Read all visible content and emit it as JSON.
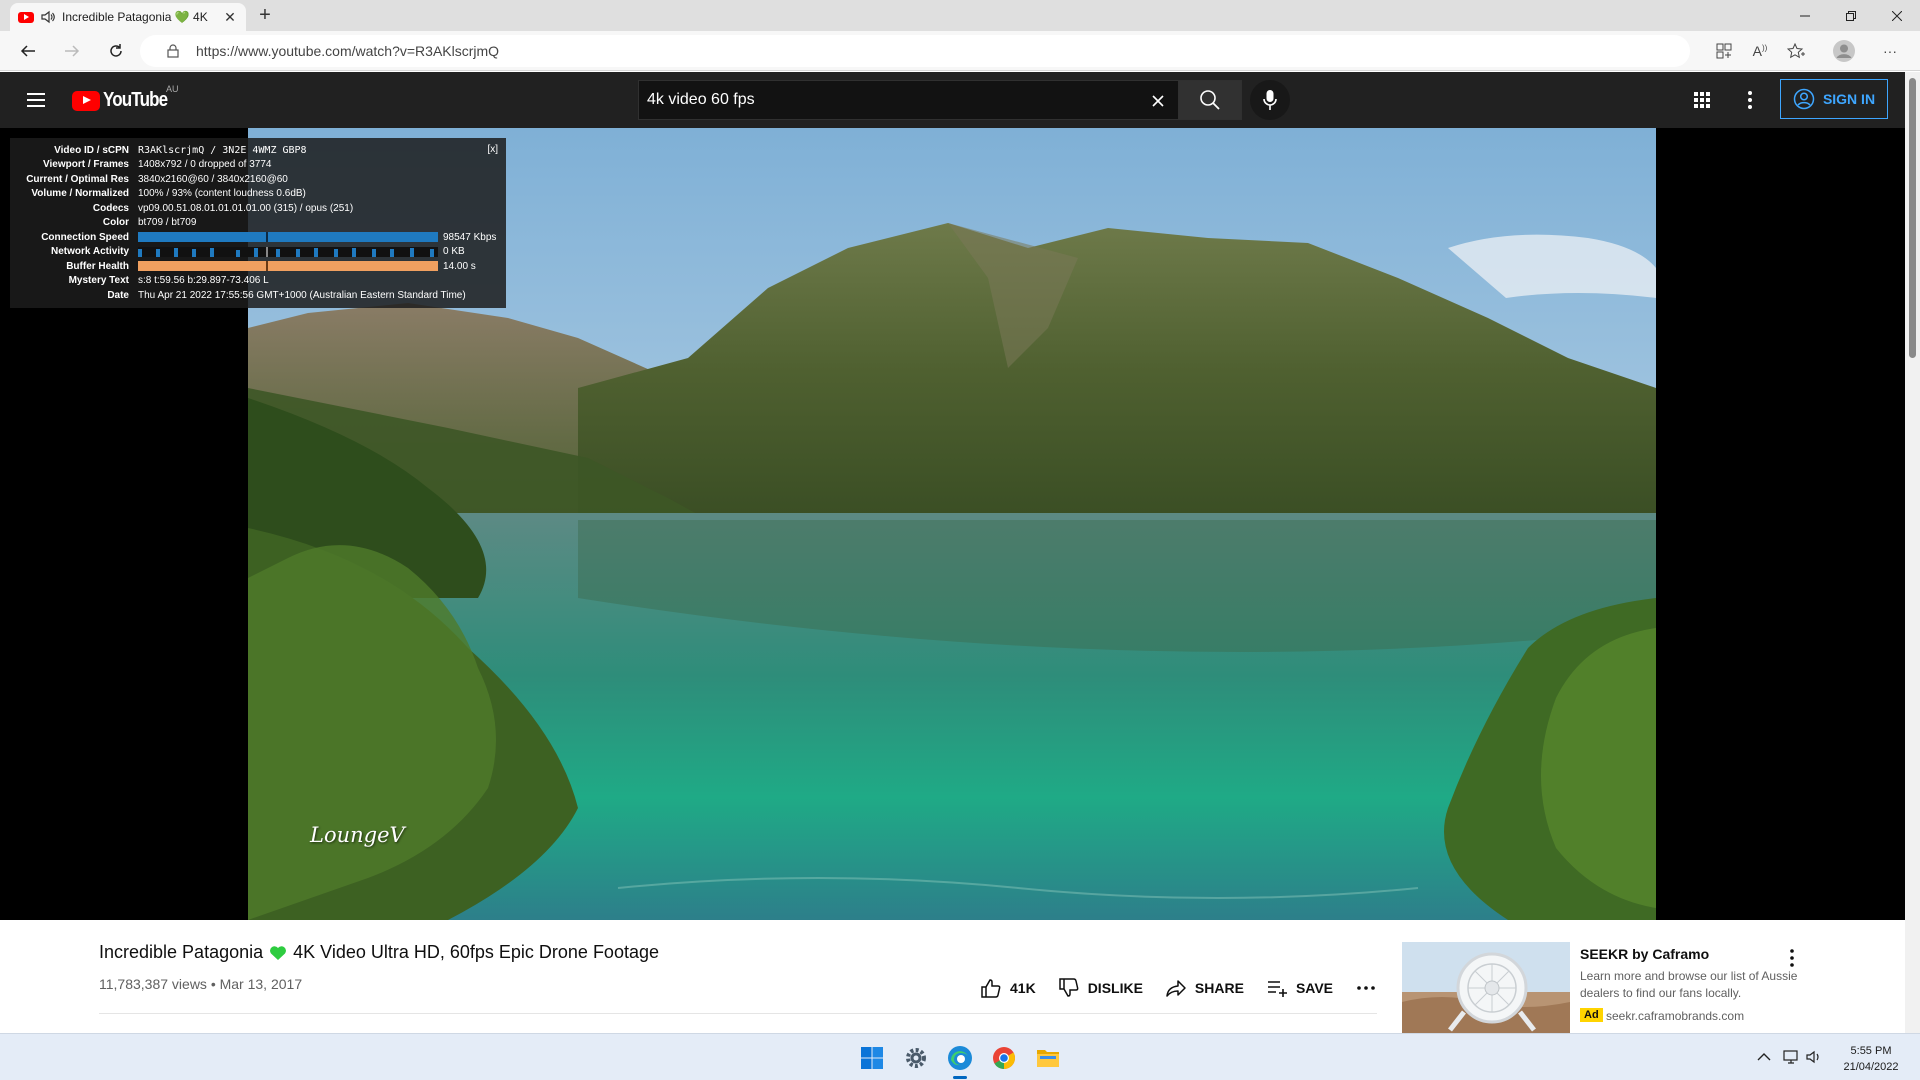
{
  "browser": {
    "tab_title": "Incredible Patagonia 💚 4K",
    "url": "https://www.youtube.com/watch?v=R3AKlscrjmQ"
  },
  "youtube": {
    "logo_text": "YouTube",
    "country": "AU",
    "search_value": "4k video 60 fps",
    "signin_label": "SIGN IN"
  },
  "stats": {
    "close": "[x]",
    "rows": [
      {
        "label": "Video ID / sCPN",
        "value": "R3AKlscrjmQ  /  3N2E  4WMZ  GBP8"
      },
      {
        "label": "Viewport / Frames",
        "value": "1408x792 / 0 dropped of 3774"
      },
      {
        "label": "Current / Optimal Res",
        "value": "3840x2160@60 / 3840x2160@60"
      },
      {
        "label": "Volume / Normalized",
        "value": "100% / 93% (content loudness 0.6dB)"
      },
      {
        "label": "Codecs",
        "value": "vp09.00.51.08.01.01.01.01.00 (315) / opus (251)"
      },
      {
        "label": "Color",
        "value": "bt709 / bt709"
      },
      {
        "label": "Connection Speed",
        "value": "98547 Kbps"
      },
      {
        "label": "Network Activity",
        "value": "0 KB"
      },
      {
        "label": "Buffer Health",
        "value": "14.00 s"
      },
      {
        "label": "Mystery Text",
        "value": "s:8 t:59.56 b:29.897-73.406 L"
      },
      {
        "label": "Date",
        "value": "Thu Apr 21 2022 17:55:56 GMT+1000 (Australian Eastern Standard Time)"
      }
    ]
  },
  "video": {
    "watermark": "LoungeV",
    "title_part1": "Incredible Patagonia",
    "title_part2": "4K Video Ultra HD, 60fps Epic Drone Footage",
    "meta": "11,783,387 views • Mar 13, 2017",
    "like_count": "41K",
    "dislike_label": "DISLIKE",
    "share_label": "SHARE",
    "save_label": "SAVE"
  },
  "ad": {
    "title": "SEEKR by Caframo",
    "description": "Learn more and browse our list of Aussie dealers to find our fans locally.",
    "badge": "Ad",
    "domain": "seekr.caframobrands.com"
  },
  "taskbar": {
    "time": "5:55 PM",
    "date": "21/04/2022"
  },
  "colors": {
    "youtube_red": "#ff0000",
    "masthead_bg": "#212121",
    "signin_blue": "#3ea6ff",
    "connection_bar": "#1f7ac0",
    "buffer_bar": "#f0a060",
    "heart_green": "#2ecc40"
  }
}
